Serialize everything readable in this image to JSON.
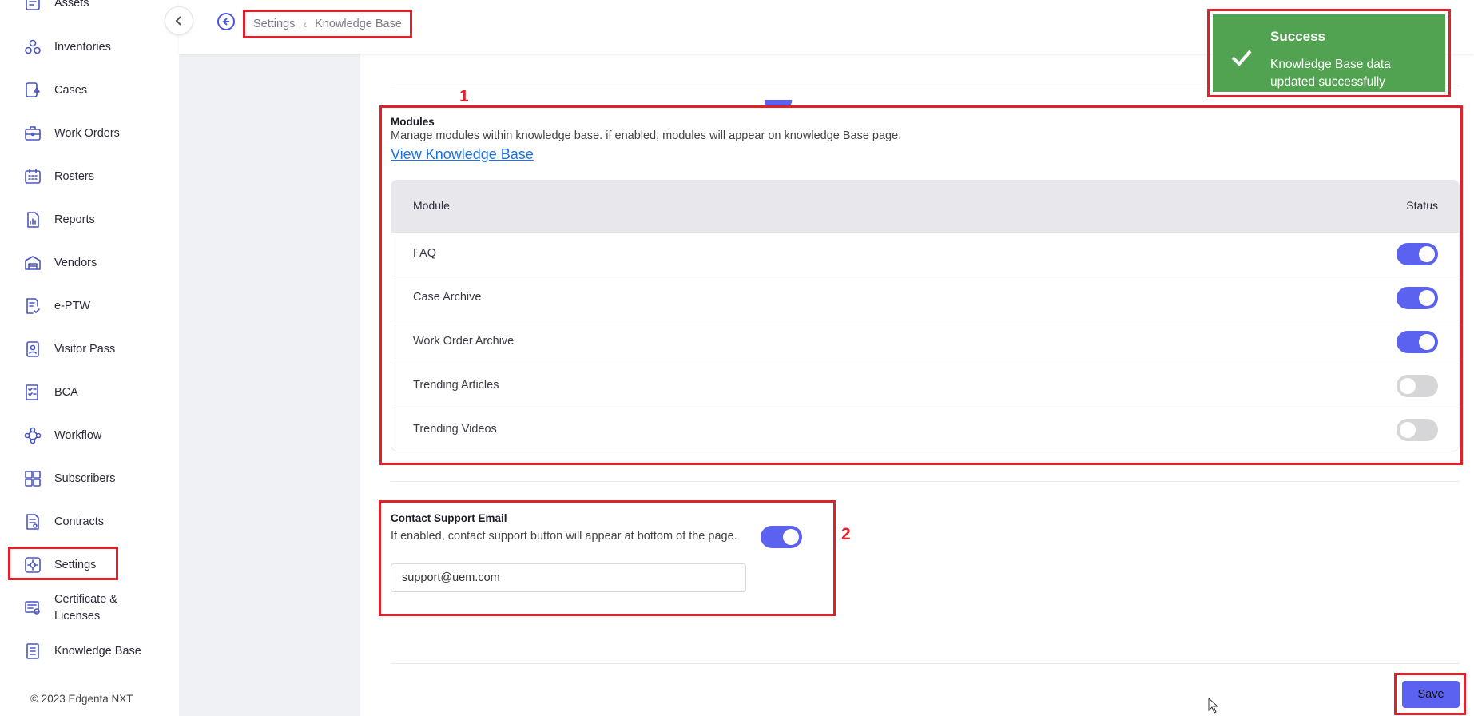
{
  "sidebar": {
    "items": [
      {
        "label": "Assets",
        "icon": "assets-icon"
      },
      {
        "label": "Inventories",
        "icon": "inventories-icon"
      },
      {
        "label": "Cases",
        "icon": "cases-icon"
      },
      {
        "label": "Work Orders",
        "icon": "work-orders-icon"
      },
      {
        "label": "Rosters",
        "icon": "rosters-icon"
      },
      {
        "label": "Reports",
        "icon": "reports-icon"
      },
      {
        "label": "Vendors",
        "icon": "vendors-icon"
      },
      {
        "label": "e-PTW",
        "icon": "eptw-icon"
      },
      {
        "label": "Visitor Pass",
        "icon": "visitor-pass-icon"
      },
      {
        "label": "BCA",
        "icon": "bca-icon"
      },
      {
        "label": "Workflow",
        "icon": "workflow-icon"
      },
      {
        "label": "Subscribers",
        "icon": "subscribers-icon"
      },
      {
        "label": "Contracts",
        "icon": "contracts-icon"
      },
      {
        "label": "Settings",
        "icon": "settings-icon"
      },
      {
        "label": "Certificate & Licenses",
        "icon": "certificate-icon"
      },
      {
        "label": "Knowledge Base",
        "icon": "knowledge-base-icon"
      }
    ],
    "copyright": "© 2023 Edgenta NXT"
  },
  "header": {
    "breadcrumb": {
      "parent": "Settings",
      "current": "Knowledge Base"
    }
  },
  "modules_section": {
    "marker": "1",
    "title": "Modules",
    "description": "Manage modules within knowledge base. if enabled, modules will appear on knowledge Base page.",
    "link": "View Knowledge Base",
    "columns": {
      "module": "Module",
      "status": "Status"
    },
    "rows": [
      {
        "name": "FAQ",
        "enabled": true
      },
      {
        "name": "Case Archive",
        "enabled": true
      },
      {
        "name": "Work Order Archive",
        "enabled": true
      },
      {
        "name": "Trending Articles",
        "enabled": false
      },
      {
        "name": "Trending Videos",
        "enabled": false
      }
    ]
  },
  "contact_section": {
    "marker": "2",
    "title": "Contact Support Email",
    "description": "If enabled, contact support button will appear at bottom of the page.",
    "enabled": true,
    "email_value": "support@uem.com"
  },
  "footer": {
    "save_label": "Save"
  },
  "toast": {
    "title": "Success",
    "message": "Knowledge Base data updated successfully"
  },
  "colors": {
    "accent": "#5b62f0",
    "success": "#51a351",
    "annotation": "#e0202a"
  }
}
